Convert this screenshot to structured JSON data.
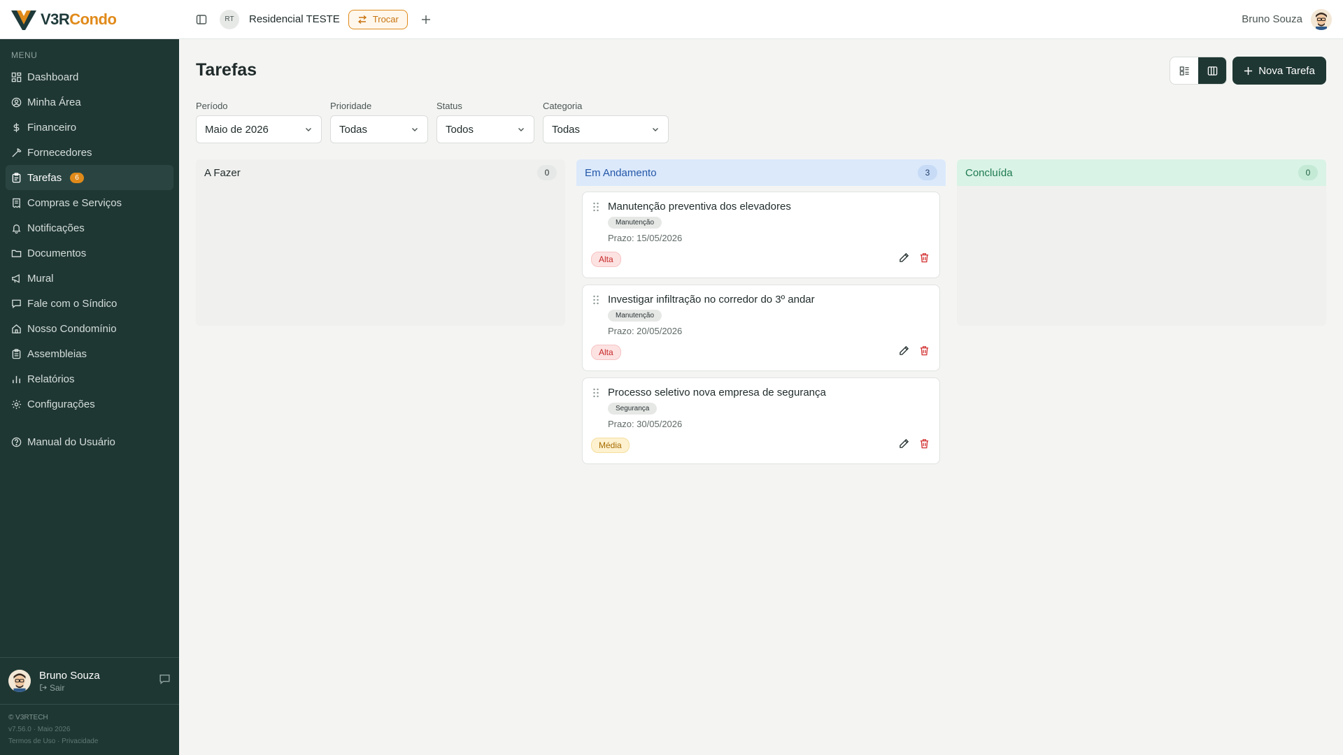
{
  "brand": {
    "logo_part1": "V3R",
    "logo_part2": "Condo",
    "accent": "#e08a1a",
    "sidebar_bg": "#1f3733"
  },
  "header": {
    "condo_initials": "RT",
    "condo_name": "Residencial TESTE",
    "switch_label": "Trocar",
    "user_name": "Bruno Souza"
  },
  "sidebar": {
    "menu_title": "MENU",
    "items": [
      {
        "label": "Dashboard",
        "icon": "dashboard-icon"
      },
      {
        "label": "Minha Área",
        "icon": "user-circle-icon"
      },
      {
        "label": "Financeiro",
        "icon": "dollar-icon"
      },
      {
        "label": "Fornecedores",
        "icon": "wrench-icon"
      },
      {
        "label": "Tarefas",
        "icon": "clipboard-icon",
        "badge": "6",
        "active": true
      },
      {
        "label": "Compras e Serviços",
        "icon": "receipt-icon"
      },
      {
        "label": "Notificações",
        "icon": "bell-icon"
      },
      {
        "label": "Documentos",
        "icon": "folder-icon"
      },
      {
        "label": "Mural",
        "icon": "megaphone-icon"
      },
      {
        "label": "Fale com o Síndico",
        "icon": "chat-icon"
      },
      {
        "label": "Nosso Condomínio",
        "icon": "home-icon"
      },
      {
        "label": "Assembleias",
        "icon": "clipboard-list-icon"
      },
      {
        "label": "Relatórios",
        "icon": "bar-chart-icon"
      },
      {
        "label": "Configurações",
        "icon": "gear-icon"
      }
    ],
    "manual_label": "Manual do Usuário",
    "user_name": "Bruno Souza",
    "logout_label": "Sair",
    "footer_line1": "© V3RTECH",
    "footer_line2": "v7.56.0 · Maio 2026",
    "terms_label": "Termos de Uso",
    "footer_sep": "·",
    "privacy_label": "Privacidade"
  },
  "page": {
    "title": "Tarefas",
    "new_task_label": "Nova Tarefa"
  },
  "filters": {
    "period": {
      "label": "Período",
      "value": "Maio de 2026"
    },
    "priority": {
      "label": "Prioridade",
      "value": "Todas"
    },
    "status": {
      "label": "Status",
      "value": "Todos"
    },
    "category": {
      "label": "Categoria",
      "value": "Todas"
    }
  },
  "columns": [
    {
      "title": "A Fazer",
      "count": "0",
      "color": "#1f2a2a"
    },
    {
      "title": "Em Andamento",
      "count": "3",
      "color": "#2457a8"
    },
    {
      "title": "Concluída",
      "count": "0",
      "color": "#1e7a4f"
    }
  ],
  "cards": [
    {
      "title": "Manutenção preventiva dos elevadores",
      "category": "Manutenção",
      "deadline": "Prazo: 15/05/2026",
      "priority": "Alta"
    },
    {
      "title": "Investigar infiltração no corredor do 3º andar",
      "category": "Manutenção",
      "deadline": "Prazo: 20/05/2026",
      "priority": "Alta"
    },
    {
      "title": "Processo seletivo nova empresa de segurança",
      "category": "Segurança",
      "deadline": "Prazo: 30/05/2026",
      "priority": "Média"
    }
  ]
}
